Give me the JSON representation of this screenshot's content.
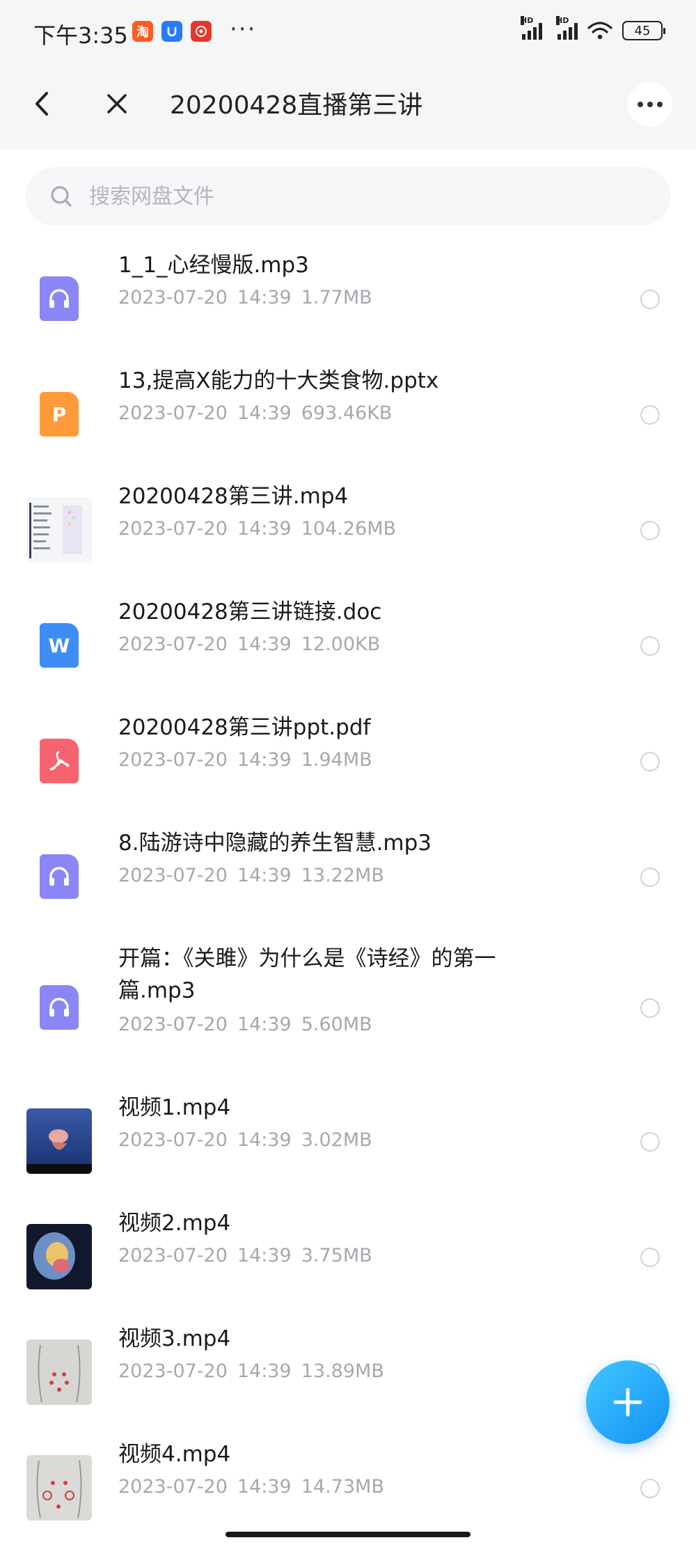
{
  "status": {
    "time": "下午3:35",
    "more": "···",
    "battery": "45",
    "hd": "HD"
  },
  "nav": {
    "title": "20200428直播第三讲",
    "more": "···"
  },
  "search": {
    "placeholder": "搜索网盘文件"
  },
  "files": [
    {
      "name": "1_1_心经慢版.mp3",
      "date": "2023-07-20",
      "time": "14:39",
      "size": "1.77MB",
      "type": "audio"
    },
    {
      "name": "13,提高X能力的十大类食物.pptx",
      "date": "2023-07-20",
      "time": "14:39",
      "size": "693.46KB",
      "type": "ppt"
    },
    {
      "name": "20200428第三讲.mp4",
      "date": "2023-07-20",
      "time": "14:39",
      "size": "104.26MB",
      "type": "video-screenshot"
    },
    {
      "name": "20200428第三讲链接.doc",
      "date": "2023-07-20",
      "time": "14:39",
      "size": "12.00KB",
      "type": "word"
    },
    {
      "name": "20200428第三讲ppt.pdf",
      "date": "2023-07-20",
      "time": "14:39",
      "size": "1.94MB",
      "type": "pdf"
    },
    {
      "name": "8.陆游诗中隐藏的养生智慧.mp3",
      "date": "2023-07-20",
      "time": "14:39",
      "size": "13.22MB",
      "type": "audio"
    },
    {
      "name": "开篇：《关雎》为什么是《诗经》的第一篇.mp3",
      "date": "2023-07-20",
      "time": "14:39",
      "size": "5.60MB",
      "type": "audio"
    },
    {
      "name": "视频1.mp4",
      "date": "2023-07-20",
      "time": "14:39",
      "size": "3.02MB",
      "type": "video"
    },
    {
      "name": "视频2.mp4",
      "date": "2023-07-20",
      "time": "14:39",
      "size": "3.75MB",
      "type": "video"
    },
    {
      "name": "视频3.mp4",
      "date": "2023-07-20",
      "time": "14:39",
      "size": "13.89MB",
      "type": "video"
    },
    {
      "name": "视频4.mp4",
      "date": "2023-07-20",
      "time": "14:39",
      "size": "14.73MB",
      "type": "video"
    }
  ],
  "icons": {
    "audio_color": "#8b86f5",
    "ppt_color": "#ff9a3c",
    "word_color": "#3d8df5",
    "pdf_color": "#f5646e",
    "fab_color": "#1a9af5",
    "ppt_letter": "P",
    "word_letter": "W"
  }
}
